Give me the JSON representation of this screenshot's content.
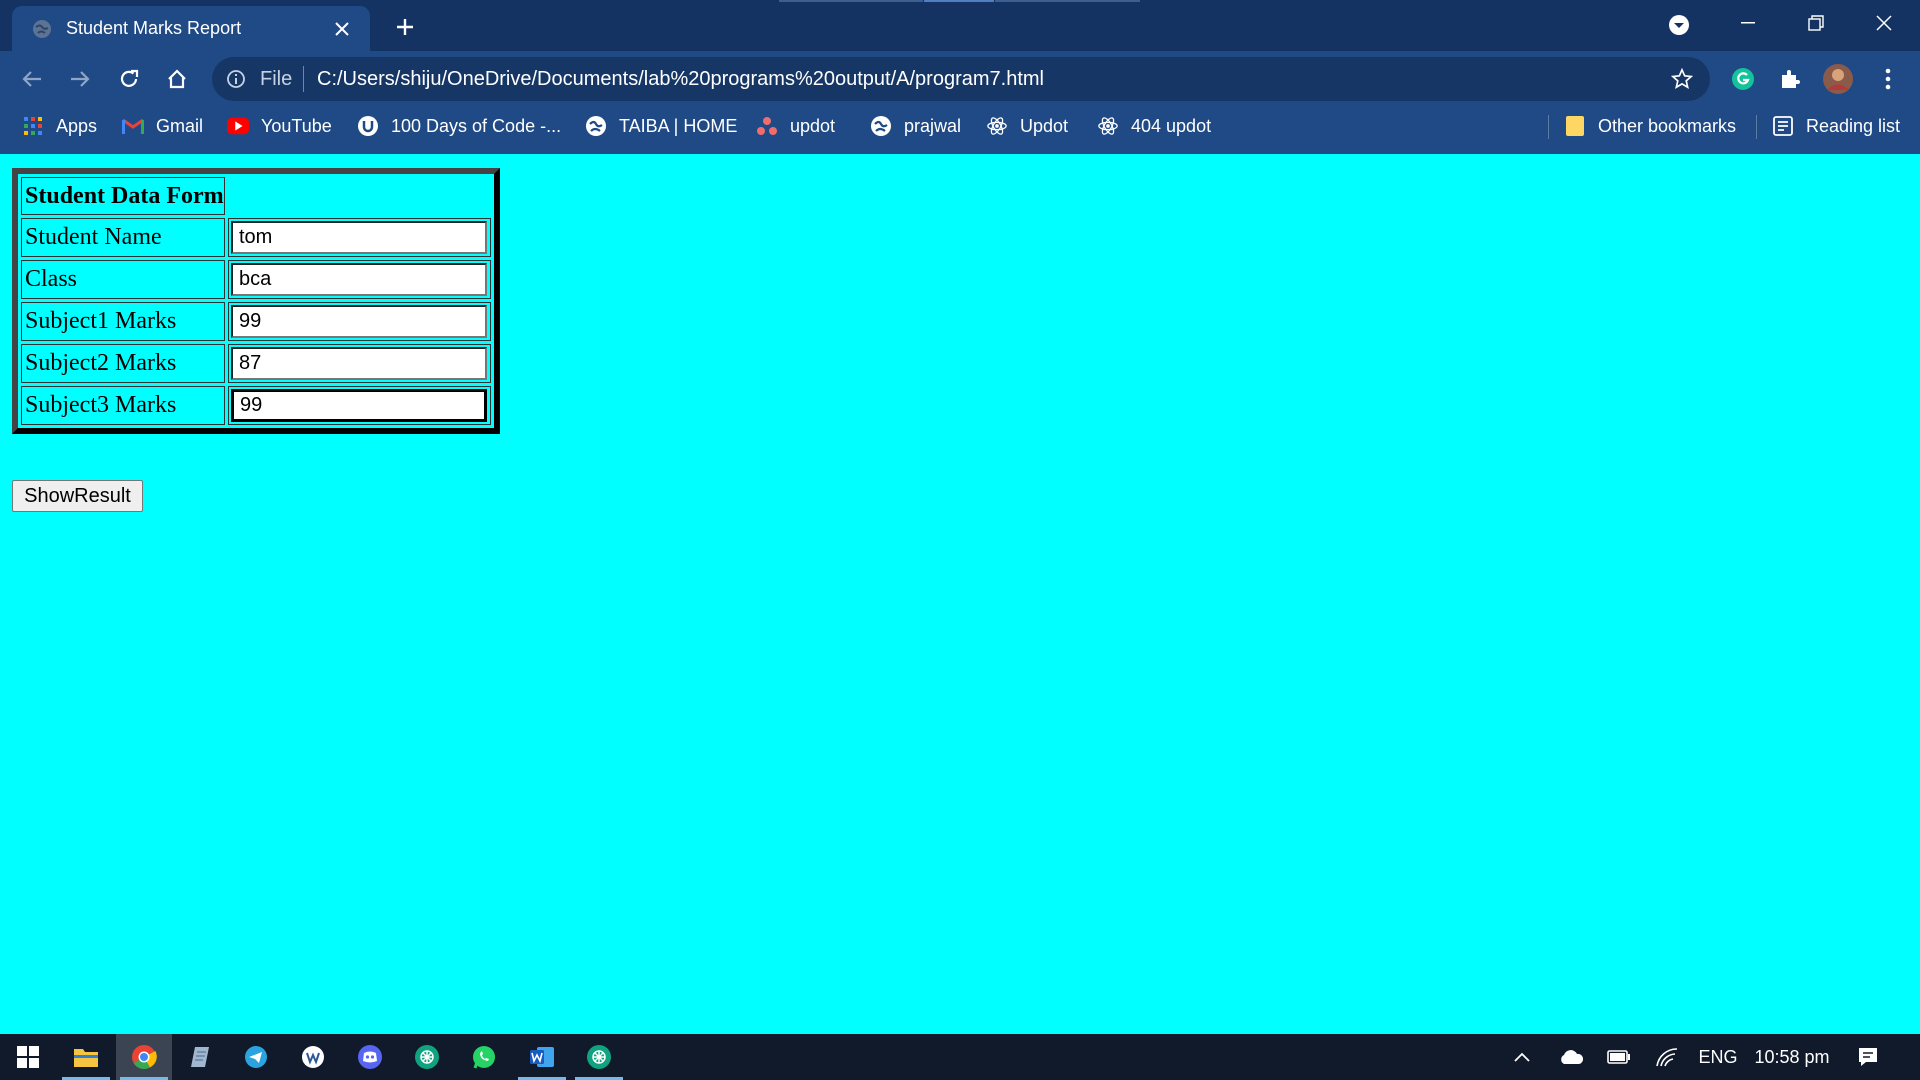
{
  "browser": {
    "tab_title": "Student Marks Report",
    "omnibox": {
      "scheme_label": "File",
      "url": "C:/Users/shiju/OneDrive/Documents/lab%20programs%20output/A/program7.html"
    },
    "bookmarks": [
      {
        "label": "Apps",
        "icon": "apps-grid-icon",
        "color": "#4285f4"
      },
      {
        "label": "Gmail",
        "icon": "gmail-icon",
        "color": "#ea4335"
      },
      {
        "label": "YouTube",
        "icon": "youtube-icon",
        "color": "#ff0000"
      },
      {
        "label": "100 Days of Code -...",
        "icon": "u-badge-icon",
        "color": "#ffffff"
      },
      {
        "label": "TAIBA | HOME",
        "icon": "globe-icon",
        "color": "#ffffff"
      },
      {
        "label": "updot",
        "icon": "updot-icon",
        "color": "#f06d6d"
      },
      {
        "label": "prajwal",
        "icon": "globe-icon",
        "color": "#ffffff"
      },
      {
        "label": "Updot",
        "icon": "react-icon",
        "color": "#ffffff"
      },
      {
        "label": "404 updot",
        "icon": "react-icon",
        "color": "#ffffff"
      }
    ],
    "other_bookmarks": "Other bookmarks",
    "reading_list": "Reading list"
  },
  "form": {
    "heading": "Student Data Form",
    "fields": [
      {
        "label": "Student Name",
        "value": "tom"
      },
      {
        "label": "Class",
        "value": "bca"
      },
      {
        "label": "Subject1 Marks",
        "value": "99"
      },
      {
        "label": "Subject2 Marks",
        "value": "87"
      },
      {
        "label": "Subject3 Marks",
        "value": "99"
      }
    ],
    "button_label": "ShowResult"
  },
  "taskbar": {
    "apps": [
      "windows-start-icon",
      "file-explorer-icon",
      "chrome-icon",
      "notepad-icon",
      "telegram-icon",
      "app-w-icon",
      "discord-icon",
      "chatgpt-icon",
      "whatsapp-icon",
      "word-icon",
      "chatgpt-icon"
    ],
    "language": "ENG",
    "time": "10:58 pm"
  },
  "colors": {
    "page_background": "#00ffff",
    "chrome_frame": "#143363",
    "chrome_toolbar": "#1f4a86"
  }
}
